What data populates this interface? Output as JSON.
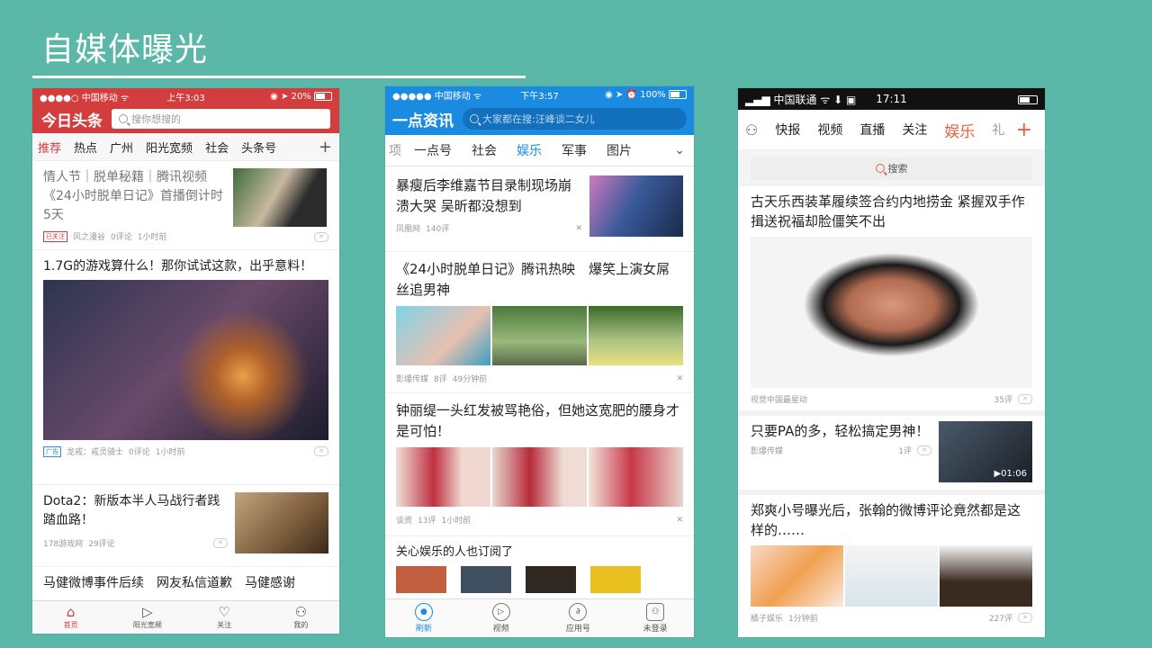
{
  "slide": {
    "title": "自媒体曝光"
  },
  "toutiao": {
    "status": {
      "carrier": "●●●●○ 中国移动 ",
      "time": "上午3:03",
      "battery": "20%"
    },
    "logo": "今日头条",
    "search_placeholder": "搜你想搜的",
    "tabs": [
      "推荐",
      "热点",
      "广州",
      "阳光宽频",
      "社会",
      "头条号"
    ],
    "articles": [
      {
        "title": "情人节｜脱单秘籍｜腾讯视频《24小时脱单日记》首播倒计时5天",
        "tag": "已关注",
        "source": "风之漫谷",
        "comments": "0评论",
        "time": "1小时前"
      },
      {
        "title": "1.7G的游戏算什么！那你试试这款，出乎意料！",
        "tag": "广告",
        "source": "龙戒：戒灵骑士",
        "comments": "0评论",
        "time": "1小时前"
      },
      {
        "title": "Dota2：新版本半人马战行者践踏血路！",
        "source": "178游戏网",
        "comments": "29评论"
      },
      {
        "title": "马健微博事件后续　网友私信道歉　马健感谢"
      }
    ],
    "nav": [
      "首页",
      "阳光宽频",
      "关注",
      "我的"
    ]
  },
  "yidian": {
    "status": {
      "carrier": "●●●●● 中国移动 ",
      "time": "下午3:57",
      "battery": "100%"
    },
    "logo": "一点资讯",
    "search_placeholder": "大家都在搜:汪峰谈二女儿",
    "tabs": [
      "项",
      "一点号",
      "社会",
      "娱乐",
      "军事",
      "图片"
    ],
    "articles": [
      {
        "title": "暴瘦后李维嘉节目录制现场崩溃大哭 吴昕都没想到",
        "source": "凤凰网",
        "comments": "140评"
      },
      {
        "title": "《24小时脱单日记》腾讯热映　爆笑上演女屌丝追男神",
        "source": "影爆传媒",
        "comments": "8评",
        "time": "49分钟前"
      },
      {
        "title": "钟丽缇一头红发被骂艳俗，但她这宽肥的腰身才是可怕！",
        "source": "谈资",
        "comments": "13评",
        "time": "1小时前"
      }
    ],
    "section": "关心娱乐的人也订阅了",
    "nav": [
      "刷新",
      "视频",
      "应用号",
      "未登录"
    ]
  },
  "unknown_app": {
    "status": {
      "carrier": "中国联通",
      "time": "17:11"
    },
    "tabs": [
      "快报",
      "视频",
      "直播",
      "关注",
      "娱乐",
      "礼"
    ],
    "search_label": "搜索",
    "articles": [
      {
        "title": "古天乐西装革履续签合约内地捞金 紧握双手作揖送祝福却脸僵笑不出",
        "source": "视觉中国最星动",
        "comments": "35评"
      },
      {
        "title": "只要PA的多，轻松搞定男神！",
        "source": "影爆传媒",
        "comments": "1评",
        "duration": "01:06"
      },
      {
        "title": "郑爽小号曝光后，张翰的微博评论竟然都是这样的……",
        "source": "橘子娱乐",
        "time": "1分钟前",
        "comments": "227评"
      }
    ]
  },
  "colors": {
    "background": "#5bb8a8",
    "toutiao_red": "#d43d3d",
    "yidian_blue": "#1a8be0",
    "accent_orange": "#e8603c"
  }
}
